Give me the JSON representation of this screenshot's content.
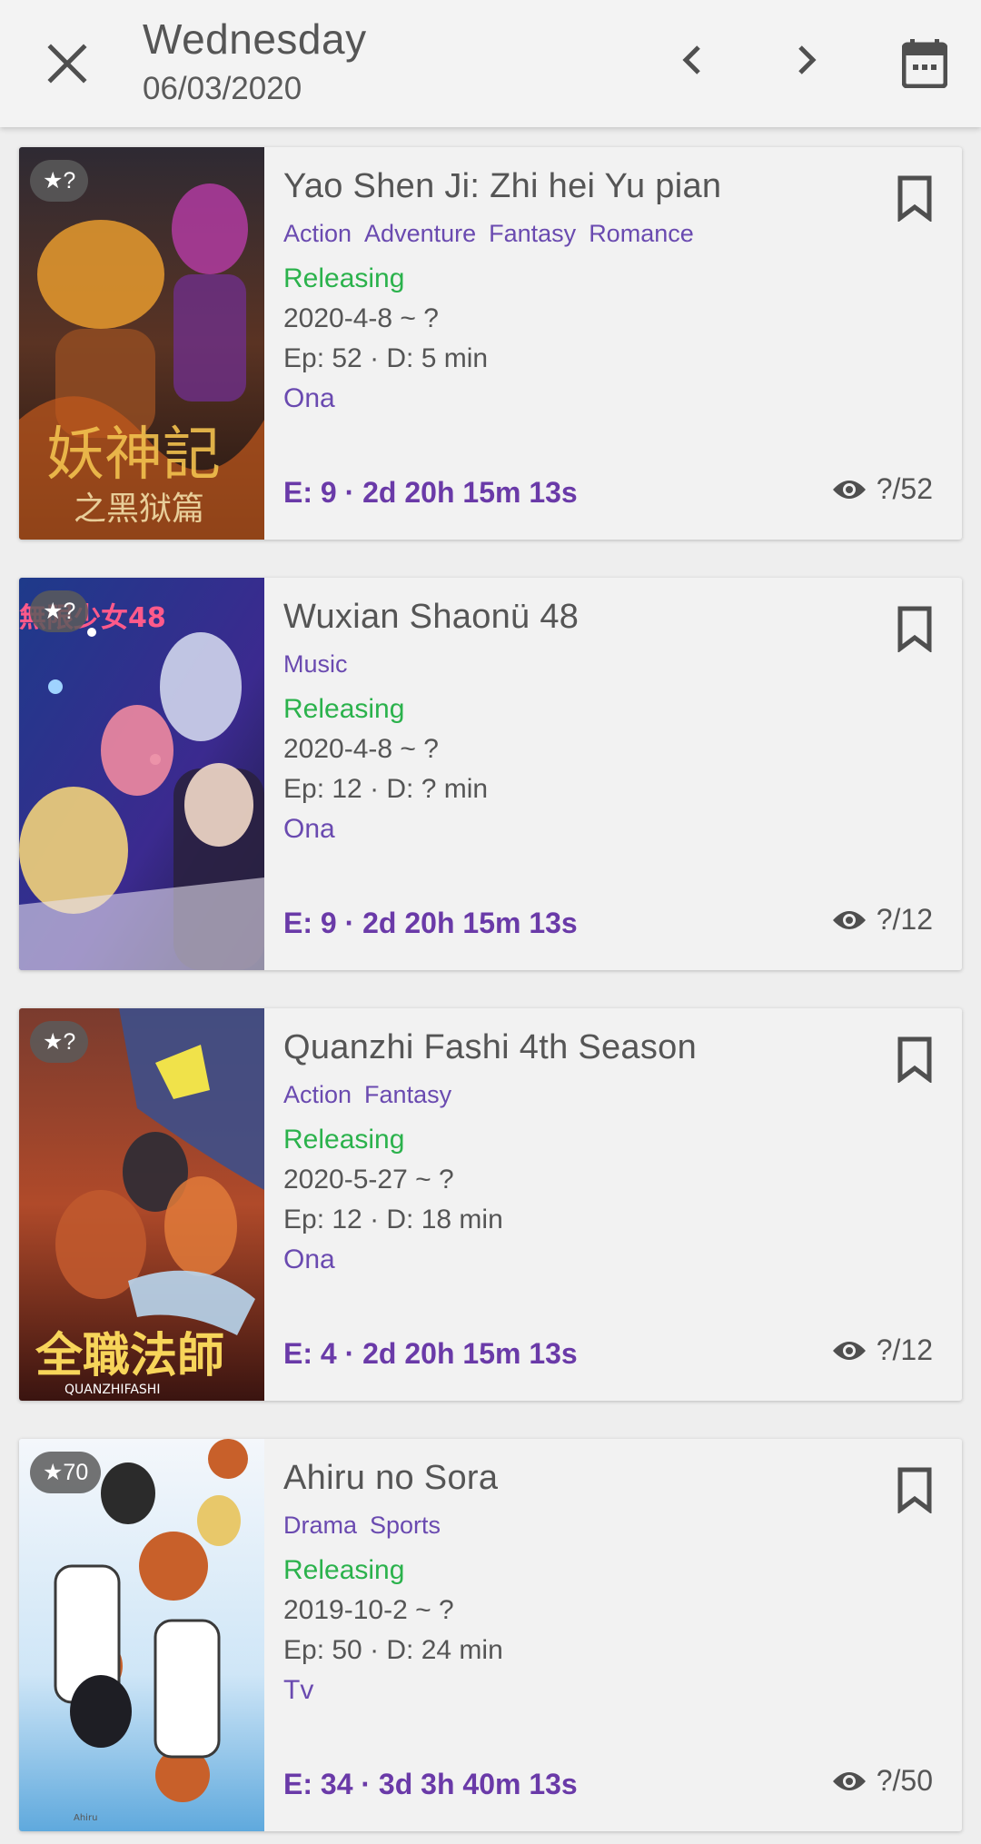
{
  "header": {
    "day": "Wednesday",
    "date": "06/03/2020"
  },
  "icons": {
    "close": "close-icon",
    "prev": "chevron-left-icon",
    "next": "chevron-right-icon",
    "calendar": "calendar-icon",
    "bookmark": "bookmark-outline-icon",
    "watch": "eye-icon"
  },
  "colors": {
    "genre": "#6a4ab0",
    "status": "#2bb24c",
    "countdown": "#6a3aa8"
  },
  "cards": [
    {
      "score": "★?",
      "title": "Yao Shen Ji: Zhi hei Yu pian",
      "genres": [
        "Action",
        "Adventure",
        "Fantasy",
        "Romance"
      ],
      "status": "Releasing",
      "dates": "2020-4-8 ~ ?",
      "eps": "Ep: 52 · D: 5 min",
      "format": "Ona",
      "countdown": "E: 9 · 2d 20h 15m 13s",
      "progress": "?/52"
    },
    {
      "score": "★?",
      "title": "Wuxian Shaonü 48",
      "genres": [
        "Music"
      ],
      "status": "Releasing",
      "dates": "2020-4-8 ~ ?",
      "eps": "Ep: 12 · D: ? min",
      "format": "Ona",
      "countdown": "E: 9 · 2d 20h 15m 13s",
      "progress": "?/12"
    },
    {
      "score": "★?",
      "title": "Quanzhi Fashi 4th Season",
      "genres": [
        "Action",
        "Fantasy"
      ],
      "status": "Releasing",
      "dates": "2020-5-27 ~ ?",
      "eps": "Ep: 12 · D: 18 min",
      "format": "Ona",
      "countdown": "E: 4 · 2d 20h 15m 13s",
      "progress": "?/12"
    },
    {
      "score": "★70",
      "title": "Ahiru no Sora",
      "genres": [
        "Drama",
        "Sports"
      ],
      "status": "Releasing",
      "dates": "2019-10-2 ~ ?",
      "eps": "Ep: 50 · D: 24 min",
      "format": "Tv",
      "countdown": "E: 34 · 3d 3h 40m 13s",
      "progress": "?/50"
    }
  ]
}
